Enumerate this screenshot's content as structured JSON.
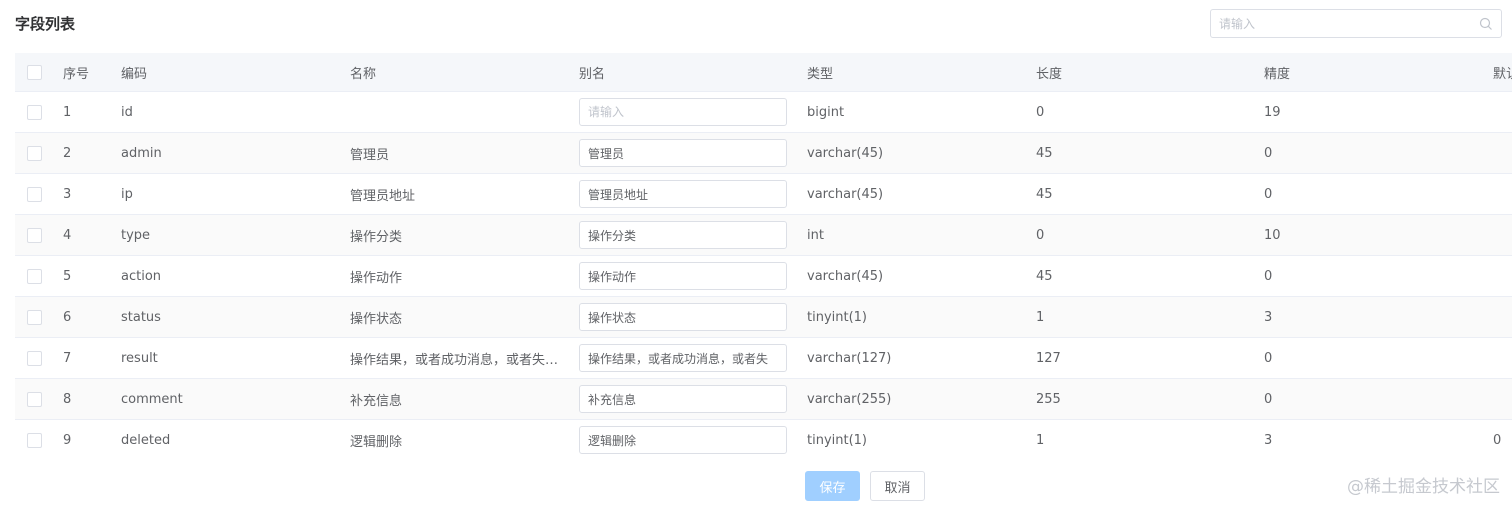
{
  "page": {
    "title": "字段列表"
  },
  "search": {
    "placeholder": "请输入"
  },
  "table": {
    "headers": [
      "序号",
      "编码",
      "名称",
      "别名",
      "类型",
      "长度",
      "精度",
      "默认"
    ],
    "rows": [
      {
        "index": "1",
        "code": "id",
        "name": "",
        "alias": "",
        "alias_placeholder": "请输入",
        "type": "bigint",
        "length": "0",
        "precision": "19",
        "default": ""
      },
      {
        "index": "2",
        "code": "admin",
        "name": "管理员",
        "alias": "管理员",
        "type": "varchar(45)",
        "length": "45",
        "precision": "0",
        "default": ""
      },
      {
        "index": "3",
        "code": "ip",
        "name": "管理员地址",
        "alias": "管理员地址",
        "type": "varchar(45)",
        "length": "45",
        "precision": "0",
        "default": ""
      },
      {
        "index": "4",
        "code": "type",
        "name": "操作分类",
        "alias": "操作分类",
        "type": "int",
        "length": "0",
        "precision": "10",
        "default": ""
      },
      {
        "index": "5",
        "code": "action",
        "name": "操作动作",
        "alias": "操作动作",
        "type": "varchar(45)",
        "length": "45",
        "precision": "0",
        "default": ""
      },
      {
        "index": "6",
        "code": "status",
        "name": "操作状态",
        "alias": "操作状态",
        "type": "tinyint(1)",
        "length": "1",
        "precision": "3",
        "default": ""
      },
      {
        "index": "7",
        "code": "result",
        "name": "操作结果，或者成功消息，或者失…",
        "alias": "操作结果，或者成功消息，或者失",
        "type": "varchar(127)",
        "length": "127",
        "precision": "0",
        "default": ""
      },
      {
        "index": "8",
        "code": "comment",
        "name": "补充信息",
        "alias": "补充信息",
        "type": "varchar(255)",
        "length": "255",
        "precision": "0",
        "default": ""
      },
      {
        "index": "9",
        "code": "deleted",
        "name": "逻辑删除",
        "alias": "逻辑删除",
        "type": "tinyint(1)",
        "length": "1",
        "precision": "3",
        "default": "0"
      }
    ]
  },
  "buttons": {
    "save": "保存",
    "cancel": "取消"
  },
  "watermark": "@稀土掘金技术社区",
  "colors": {
    "primary_disabled": "#a0cfff",
    "border": "#dcdfe6",
    "header_bg": "#f5f7fa"
  }
}
